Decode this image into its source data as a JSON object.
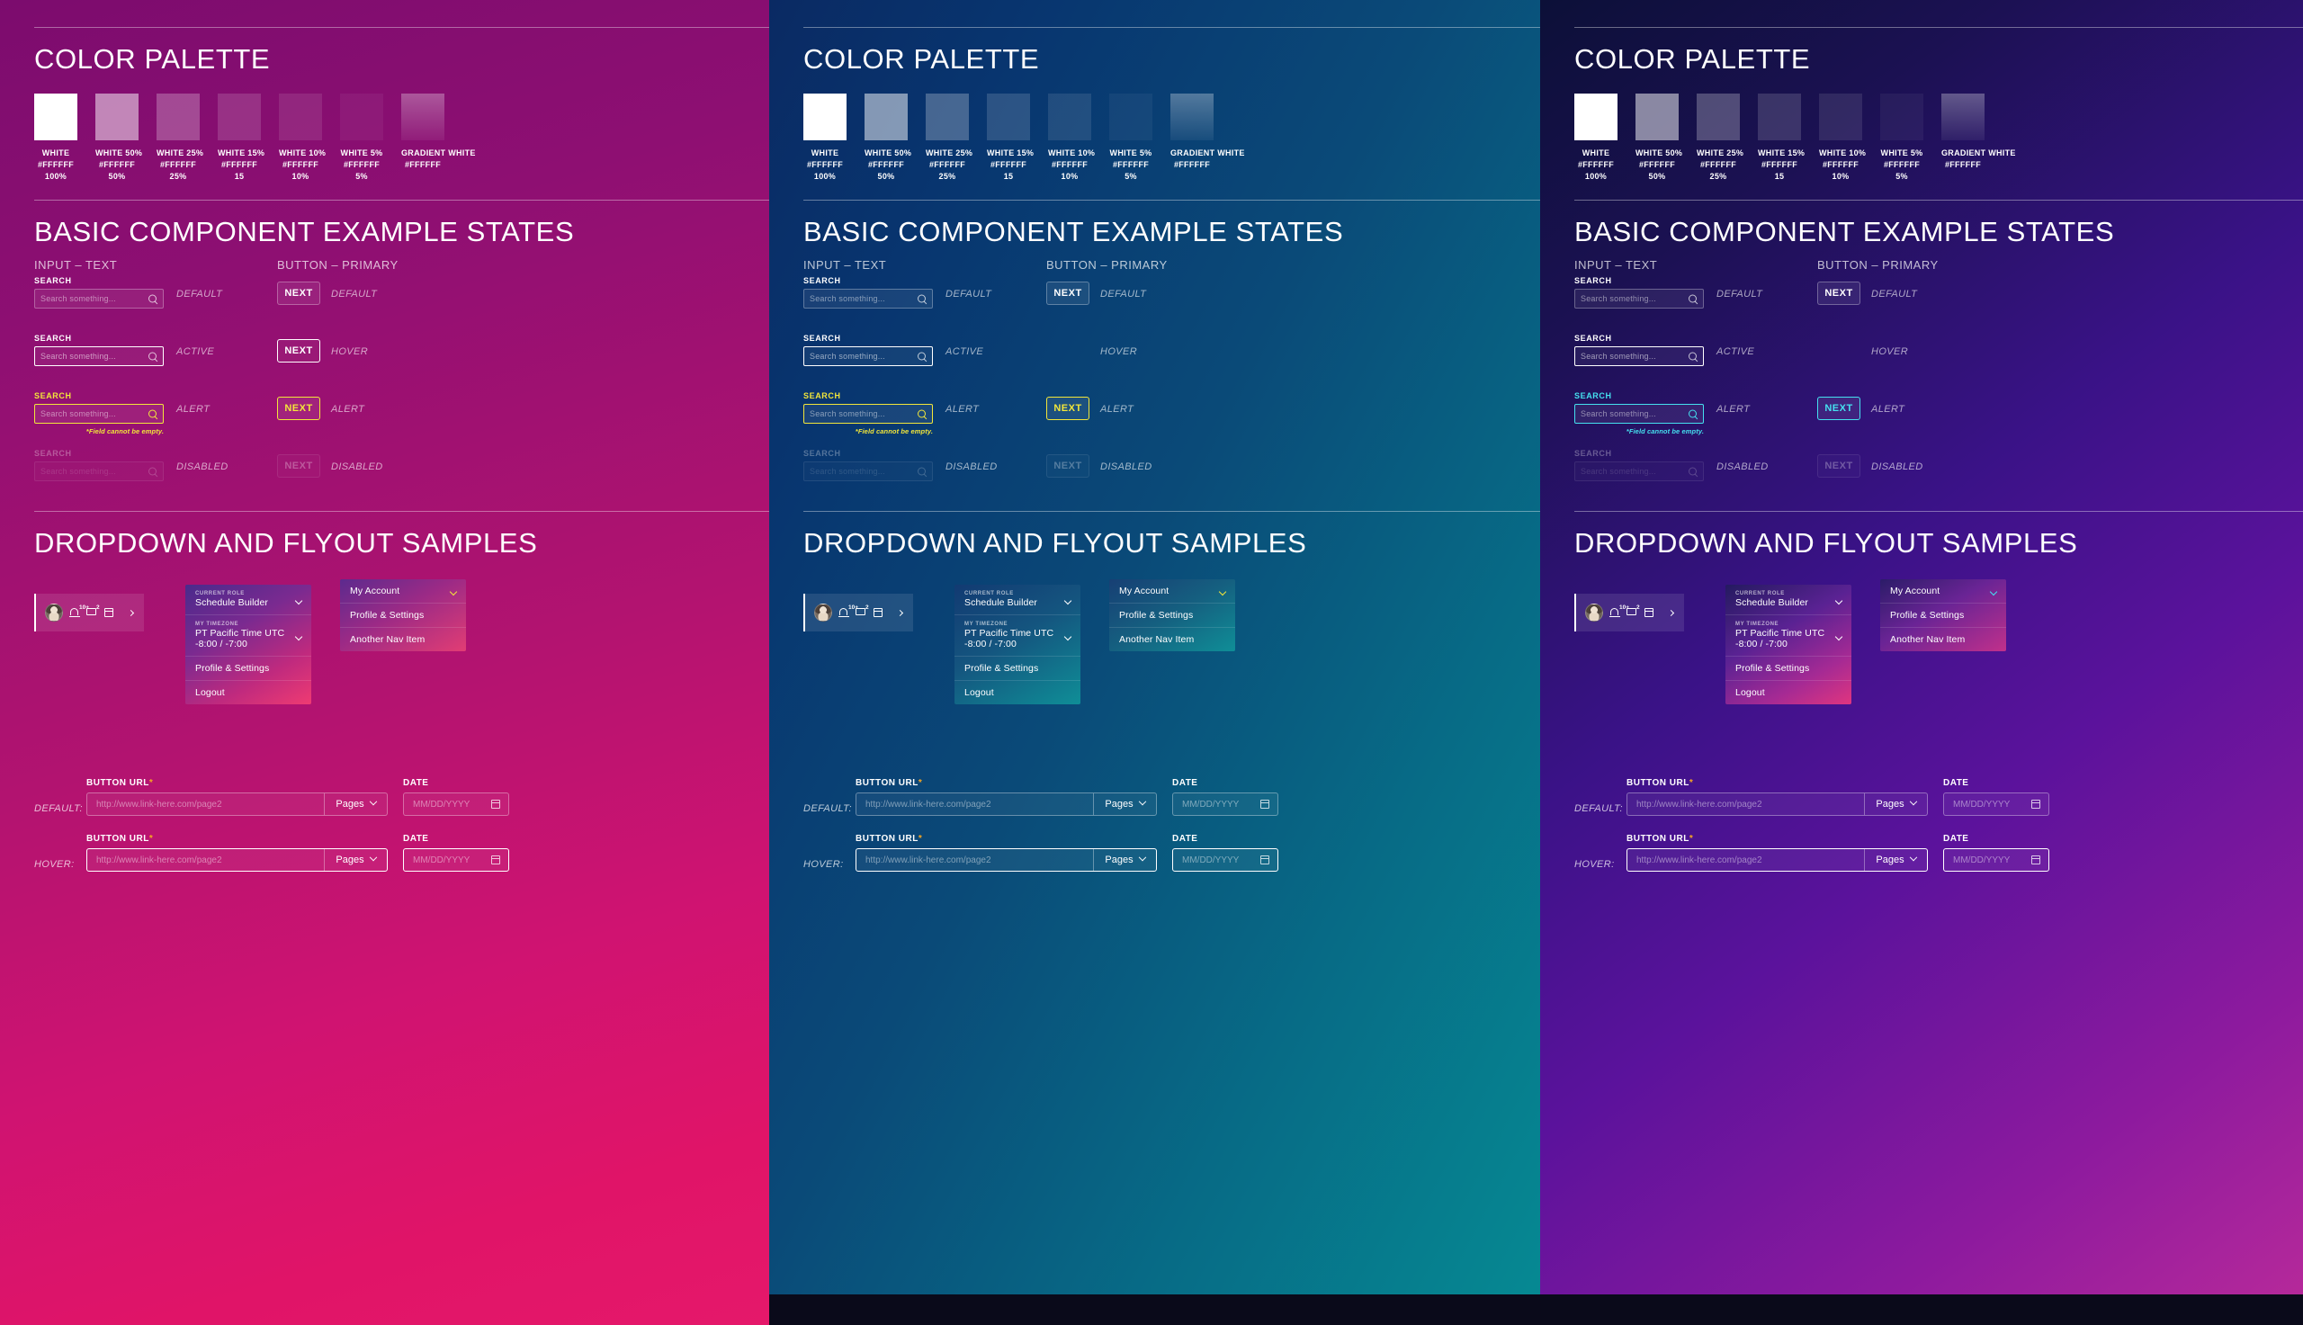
{
  "panels": [
    {
      "theme": "magenta",
      "accent": "#f2e63a",
      "palette": {
        "heading": "COLOR PALETTE",
        "swatches": [
          {
            "name": "WHITE",
            "hex": "#FFFFFF",
            "pct": "100%",
            "alpha": 1.0
          },
          {
            "name": "WHITE 50%",
            "hex": "#FFFFFF",
            "pct": "50%",
            "alpha": 0.5
          },
          {
            "name": "WHITE 25%",
            "hex": "#FFFFFF",
            "pct": "25%",
            "alpha": 0.25
          },
          {
            "name": "WHITE 15%",
            "hex": "#FFFFFF",
            "pct": "15",
            "alpha": 0.15
          },
          {
            "name": "WHITE 10%",
            "hex": "#FFFFFF",
            "pct": "10%",
            "alpha": 0.1
          },
          {
            "name": "WHITE 5%",
            "hex": "#FFFFFF",
            "pct": "5%",
            "alpha": 0.05
          },
          {
            "name": "GRADIENT WHITE",
            "hex": "#FFFFFF",
            "pct": "",
            "alpha": 0.18
          }
        ]
      },
      "basic": {
        "heading": "BASIC COMPONENT EXAMPLE STATES",
        "col_input": "INPUT – TEXT",
        "col_button": "BUTTON – PRIMARY",
        "field_label": "SEARCH",
        "placeholder": "Search something...",
        "error": "*Field cannot be empty.",
        "button_label": "NEXT",
        "input_states": [
          "DEFAULT",
          "ACTIVE",
          "ALERT",
          "DISABLED"
        ],
        "button_states": [
          "DEFAULT",
          "HOVER",
          "ALERT",
          "DISABLED"
        ]
      },
      "dropdown": {
        "heading": "DROPDOWN AND FLYOUT SAMPLES",
        "bell_badge": "10+",
        "chat_badge": "2",
        "flyout_role": {
          "role_key": "CURRENT ROLE",
          "role_value": "Schedule Builder",
          "tz_key": "MY TIMEZONE",
          "tz_value": "PT  Pacific Time  UTC -8:00 / -7:00",
          "items": [
            "Profile & Settings",
            "Logout"
          ]
        },
        "flyout_account": {
          "title": "My Account",
          "items": [
            "Profile & Settings",
            "Another Nav Item"
          ]
        }
      },
      "forms": {
        "url_label": "BUTTON URL",
        "url_required": "*",
        "url_placeholder": "http://www.link-here.com/page2",
        "pages_label": "Pages",
        "date_label": "DATE",
        "date_placeholder": "MM/DD/YYYY",
        "states": [
          "DEFAULT:",
          "HOVER:"
        ]
      }
    },
    {
      "theme": "blue",
      "accent": "#f2e63a",
      "palette": {
        "heading": "COLOR PALETTE",
        "swatches": [
          {
            "name": "WHITE",
            "hex": "#FFFFFF",
            "pct": "100%",
            "alpha": 1.0
          },
          {
            "name": "WHITE 50%",
            "hex": "#FFFFFF",
            "pct": "50%",
            "alpha": 0.5
          },
          {
            "name": "WHITE 25%",
            "hex": "#FFFFFF",
            "pct": "25%",
            "alpha": 0.25
          },
          {
            "name": "WHITE 15%",
            "hex": "#FFFFFF",
            "pct": "15",
            "alpha": 0.15
          },
          {
            "name": "WHITE 10%",
            "hex": "#FFFFFF",
            "pct": "10%",
            "alpha": 0.1
          },
          {
            "name": "WHITE 5%",
            "hex": "#FFFFFF",
            "pct": "5%",
            "alpha": 0.05
          },
          {
            "name": "GRADIENT WHITE",
            "hex": "#FFFFFF",
            "pct": "",
            "alpha": 0.18
          }
        ]
      },
      "basic": {
        "heading": "BASIC COMPONENT EXAMPLE STATES",
        "col_input": "INPUT – TEXT",
        "col_button": "BUTTON – PRIMARY",
        "field_label": "SEARCH",
        "placeholder": "Search something...",
        "error": "*Field cannot be empty.",
        "button_label": "NEXT",
        "input_states": [
          "DEFAULT",
          "ACTIVE",
          "ALERT",
          "DISABLED"
        ],
        "button_states": [
          "DEFAULT",
          "HOVER",
          "ALERT",
          "DISABLED"
        ]
      },
      "dropdown": {
        "heading": "DROPDOWN AND FLYOUT SAMPLES",
        "bell_badge": "10+",
        "chat_badge": "2",
        "flyout_role": {
          "role_key": "CURRENT ROLE",
          "role_value": "Schedule Builder",
          "tz_key": "MY TIMEZONE",
          "tz_value": "PT  Pacific Time  UTC -8:00 / -7:00",
          "items": [
            "Profile & Settings",
            "Logout"
          ]
        },
        "flyout_account": {
          "title": "My Account",
          "items": [
            "Profile & Settings",
            "Another Nav Item"
          ]
        }
      },
      "forms": {
        "url_label": "BUTTON URL",
        "url_required": "*",
        "url_placeholder": "http://www.link-here.com/page2",
        "pages_label": "Pages",
        "date_label": "DATE",
        "date_placeholder": "MM/DD/YYYY",
        "states": [
          "DEFAULT:",
          "HOVER:"
        ]
      }
    },
    {
      "theme": "purple",
      "accent": "#45e0ef",
      "palette": {
        "heading": "COLOR PALETTE",
        "swatches": [
          {
            "name": "WHITE",
            "hex": "#FFFFFF",
            "pct": "100%",
            "alpha": 1.0
          },
          {
            "name": "WHITE 50%",
            "hex": "#FFFFFF",
            "pct": "50%",
            "alpha": 0.5
          },
          {
            "name": "WHITE 25%",
            "hex": "#FFFFFF",
            "pct": "25%",
            "alpha": 0.25
          },
          {
            "name": "WHITE 15%",
            "hex": "#FFFFFF",
            "pct": "15",
            "alpha": 0.15
          },
          {
            "name": "WHITE 10%",
            "hex": "#FFFFFF",
            "pct": "10%",
            "alpha": 0.1
          },
          {
            "name": "WHITE 5%",
            "hex": "#FFFFFF",
            "pct": "5%",
            "alpha": 0.05
          },
          {
            "name": "GRADIENT WHITE",
            "hex": "#FFFFFF",
            "pct": "",
            "alpha": 0.18
          }
        ]
      },
      "basic": {
        "heading": "BASIC COMPONENT EXAMPLE STATES",
        "col_input": "INPUT – TEXT",
        "col_button": "BUTTON – PRIMARY",
        "field_label": "SEARCH",
        "placeholder": "Search something...",
        "error": "*Field cannot be empty.",
        "button_label": "NEXT",
        "input_states": [
          "DEFAULT",
          "ACTIVE",
          "ALERT",
          "DISABLED"
        ],
        "button_states": [
          "DEFAULT",
          "HOVER",
          "ALERT",
          "DISABLED"
        ]
      },
      "dropdown": {
        "heading": "DROPDOWN AND FLYOUT SAMPLES",
        "bell_badge": "10+",
        "chat_badge": "2",
        "flyout_role": {
          "role_key": "CURRENT ROLE",
          "role_value": "Schedule Builder",
          "tz_key": "MY TIMEZONE",
          "tz_value": "PT  Pacific Time  UTC -8:00 / -7:00",
          "items": [
            "Profile & Settings",
            "Logout"
          ]
        },
        "flyout_account": {
          "title": "My Account",
          "items": [
            "Profile & Settings",
            "Another Nav Item"
          ]
        }
      },
      "forms": {
        "url_label": "BUTTON URL",
        "url_required": "*",
        "url_placeholder": "http://www.link-here.com/page2",
        "pages_label": "Pages",
        "date_label": "DATE",
        "date_placeholder": "MM/DD/YYYY",
        "states": [
          "DEFAULT:",
          "HOVER:"
        ]
      }
    }
  ]
}
